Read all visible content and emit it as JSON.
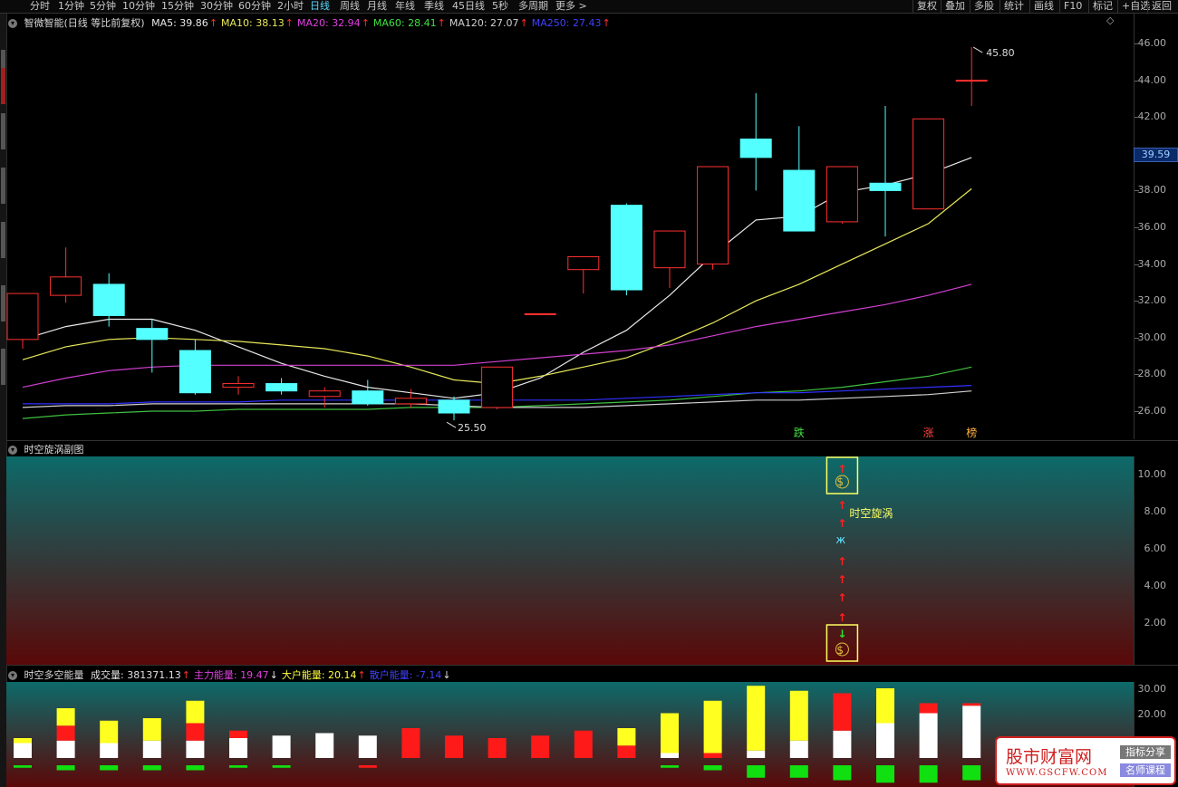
{
  "toolbar": {
    "tabs": [
      "分时",
      "1分钟",
      "5分钟",
      "10分钟",
      "15分钟",
      "30分钟",
      "60分钟",
      "2小时",
      "日线",
      "周线",
      "月线",
      "年线",
      "季线",
      "45日线",
      "5秒",
      "多周期",
      "更多 >"
    ],
    "right_tabs": [
      "复权",
      "叠加",
      "多股",
      "统计",
      "画线",
      "F10",
      "标记",
      "+自选",
      "返回"
    ]
  },
  "main_panel": {
    "title": "智微智能(日线 等比前复权)",
    "ma": [
      {
        "label": "MA5: 39.86",
        "arrow": "↑",
        "color": "#e8e8e8"
      },
      {
        "label": "MA10: 38.13",
        "arrow": "↑",
        "color": "#e8e85a"
      },
      {
        "label": "MA20: 32.94",
        "arrow": "↑",
        "color": "#e040e0"
      },
      {
        "label": "MA60: 28.41",
        "arrow": "↑",
        "color": "#40e040"
      },
      {
        "label": "MA120: 27.07",
        "arrow": "↑",
        "color": "#d0d0d0"
      },
      {
        "label": "MA250: 27.43",
        "arrow": "↑",
        "color": "#4040ff"
      }
    ],
    "diamond_icon": "diamond-icon",
    "price_badge": "39.59",
    "high_label": "45.80",
    "low_label": "25.50",
    "axis": [
      "46.00",
      "44.00",
      "42.00",
      "40.00",
      "38.00",
      "36.00",
      "34.00",
      "32.00",
      "30.00",
      "28.00",
      "26.00"
    ],
    "signals": [
      {
        "text": "跌",
        "color": "#40e040"
      },
      {
        "text": "涨",
        "color": "#ff4040"
      },
      {
        "text": "榜",
        "color": "#ffb040"
      }
    ]
  },
  "colors": {
    "up": "#ff3030",
    "down": "#54ffff",
    "bg": "#000000"
  },
  "candles": [
    {
      "o": 29.9,
      "c": 32.4,
      "h": 32.4,
      "l": 29.4
    },
    {
      "o": 32.3,
      "c": 33.3,
      "h": 34.9,
      "l": 31.9
    },
    {
      "o": 32.9,
      "c": 31.2,
      "h": 33.5,
      "l": 30.6
    },
    {
      "o": 30.5,
      "c": 29.9,
      "h": 31.0,
      "l": 28.1
    },
    {
      "o": 29.3,
      "c": 27.0,
      "h": 29.9,
      "l": 26.9
    },
    {
      "o": 27.3,
      "c": 27.5,
      "h": 27.9,
      "l": 26.9
    },
    {
      "o": 27.5,
      "c": 27.1,
      "h": 27.8,
      "l": 26.9
    },
    {
      "o": 26.8,
      "c": 27.1,
      "h": 27.3,
      "l": 26.2
    },
    {
      "o": 27.1,
      "c": 26.4,
      "h": 27.7,
      "l": 26.3
    },
    {
      "o": 26.4,
      "c": 26.7,
      "h": 27.2,
      "l": 26.2
    },
    {
      "o": 26.6,
      "c": 25.9,
      "h": 26.8,
      "l": 25.5
    },
    {
      "o": 26.2,
      "c": 28.4,
      "h": 28.4,
      "l": 26.1
    },
    {
      "o": 31.3,
      "c": 31.3,
      "h": 31.3,
      "l": 31.3
    },
    {
      "o": 33.7,
      "c": 34.4,
      "h": 34.4,
      "l": 32.4
    },
    {
      "o": 37.2,
      "c": 32.6,
      "h": 37.3,
      "l": 32.3
    },
    {
      "o": 33.8,
      "c": 35.8,
      "h": 35.8,
      "l": 32.7
    },
    {
      "o": 34.0,
      "c": 39.3,
      "h": 39.3,
      "l": 33.7
    },
    {
      "o": 40.8,
      "c": 39.8,
      "h": 43.3,
      "l": 38.0
    },
    {
      "o": 39.1,
      "c": 35.8,
      "h": 41.5,
      "l": 35.8
    },
    {
      "o": 36.3,
      "c": 39.3,
      "h": 39.3,
      "l": 36.2
    },
    {
      "o": 38.4,
      "c": 38.0,
      "h": 42.6,
      "l": 35.5
    },
    {
      "o": 37.0,
      "c": 41.9,
      "h": 41.9,
      "l": 37.0
    },
    {
      "o": 44.0,
      "c": 44.0,
      "h": 45.8,
      "l": 42.6
    }
  ],
  "ma_lines": {
    "ma5": [
      29.9,
      30.6,
      31.0,
      31.0,
      30.4,
      29.5,
      28.6,
      27.9,
      27.3,
      27.0,
      26.7,
      27.0,
      27.8,
      29.2,
      30.4,
      32.3,
      34.5,
      36.4,
      36.6,
      37.9,
      38.3,
      38.9,
      39.8
    ],
    "ma10": [
      28.8,
      29.5,
      29.9,
      30.0,
      29.9,
      29.8,
      29.6,
      29.4,
      29.0,
      28.4,
      27.7,
      27.5,
      27.9,
      28.4,
      28.9,
      29.8,
      30.8,
      32.0,
      32.9,
      34.0,
      35.1,
      36.2,
      38.1
    ],
    "ma20": [
      27.3,
      27.8,
      28.2,
      28.4,
      28.5,
      28.5,
      28.5,
      28.5,
      28.5,
      28.5,
      28.5,
      28.7,
      28.9,
      29.1,
      29.3,
      29.6,
      30.1,
      30.6,
      31.0,
      31.4,
      31.8,
      32.3,
      32.9
    ],
    "ma60": [
      25.6,
      25.8,
      25.9,
      26.0,
      26.0,
      26.1,
      26.1,
      26.1,
      26.1,
      26.2,
      26.2,
      26.2,
      26.3,
      26.4,
      26.5,
      26.6,
      26.8,
      27.0,
      27.1,
      27.3,
      27.6,
      27.9,
      28.4
    ],
    "ma120": [
      26.2,
      26.3,
      26.3,
      26.4,
      26.4,
      26.4,
      26.4,
      26.4,
      26.4,
      26.4,
      26.3,
      26.2,
      26.2,
      26.2,
      26.3,
      26.4,
      26.5,
      26.6,
      26.6,
      26.7,
      26.8,
      26.9,
      27.1
    ],
    "ma250": [
      26.4,
      26.4,
      26.4,
      26.5,
      26.5,
      26.5,
      26.6,
      26.6,
      26.6,
      26.6,
      26.6,
      26.6,
      26.6,
      26.6,
      26.7,
      26.8,
      26.9,
      27.0,
      27.0,
      27.1,
      27.2,
      27.3,
      27.4
    ]
  },
  "sub1": {
    "title": "时空旋涡副图",
    "label": "时空旋涡",
    "axis": [
      "10.00",
      "8.00",
      "6.00",
      "4.00",
      "2.00"
    ],
    "icons": [
      "money-bag-icon",
      "butterfly-icon",
      "up-arrow-icon",
      "down-arrow-icon"
    ]
  },
  "sub2": {
    "title": "时空多空能量",
    "items": [
      {
        "label": "成交量: 381371.13",
        "arrow": "↑",
        "color": "#e0e0e0"
      },
      {
        "label": "主力能量: 19.47",
        "arrow": "↓",
        "color": "#e040e0"
      },
      {
        "label": "大户能量: 20.14",
        "arrow": "↑",
        "color": "#ffff40"
      },
      {
        "label": "散户能量: -7.14",
        "arrow": "↓",
        "color": "#4040ff"
      }
    ],
    "axis": [
      "30.00",
      "20.00"
    ],
    "bars": [
      {
        "w": 6,
        "y": 2,
        "r": 0,
        "g": 1
      },
      {
        "w": 7,
        "y": 7,
        "r": 6,
        "g": 2
      },
      {
        "w": 6,
        "y": 9,
        "r": 0,
        "g": 2
      },
      {
        "w": 7,
        "y": 9,
        "r": 0,
        "g": 2
      },
      {
        "w": 7,
        "y": 9,
        "r": 7,
        "g": 2
      },
      {
        "w": 8,
        "y": 0,
        "r": 3,
        "g": 1
      },
      {
        "w": 9,
        "y": 0,
        "r": 0,
        "g": 1
      },
      {
        "w": 10,
        "y": 0,
        "r": 0,
        "g": 0
      },
      {
        "w": 9,
        "y": 0,
        "r": 0,
        "g": -1
      },
      {
        "w": 0,
        "y": 0,
        "r": 12,
        "g": 0
      },
      {
        "w": 0,
        "y": 0,
        "r": 9,
        "g": 0
      },
      {
        "w": 0,
        "y": 0,
        "r": 8,
        "g": 0
      },
      {
        "w": 0,
        "y": 0,
        "r": 9,
        "g": 0
      },
      {
        "w": 0,
        "y": 0,
        "r": 11,
        "g": 0
      },
      {
        "w": 0,
        "y": 7,
        "r": 5,
        "g": 0
      },
      {
        "w": 2,
        "y": 16,
        "r": 0,
        "g": 1
      },
      {
        "w": 0,
        "y": 21,
        "r": 2,
        "g": 2
      },
      {
        "w": 3,
        "y": 26,
        "r": 0,
        "g": 5
      },
      {
        "w": 7,
        "y": 20,
        "r": 0,
        "g": 5
      },
      {
        "w": 11,
        "y": 0,
        "r": 15,
        "g": 6
      },
      {
        "w": 14,
        "y": 14,
        "r": 0,
        "g": 7
      },
      {
        "w": 18,
        "y": 0,
        "r": 4,
        "g": 7
      },
      {
        "w": 21,
        "y": 0,
        "r": 1,
        "g": 6
      }
    ]
  },
  "watermark": {
    "title": "股市财富网",
    "url": "WWW.GSCFW.COM",
    "badge1": "指标分享",
    "badge2": "名师课程"
  }
}
